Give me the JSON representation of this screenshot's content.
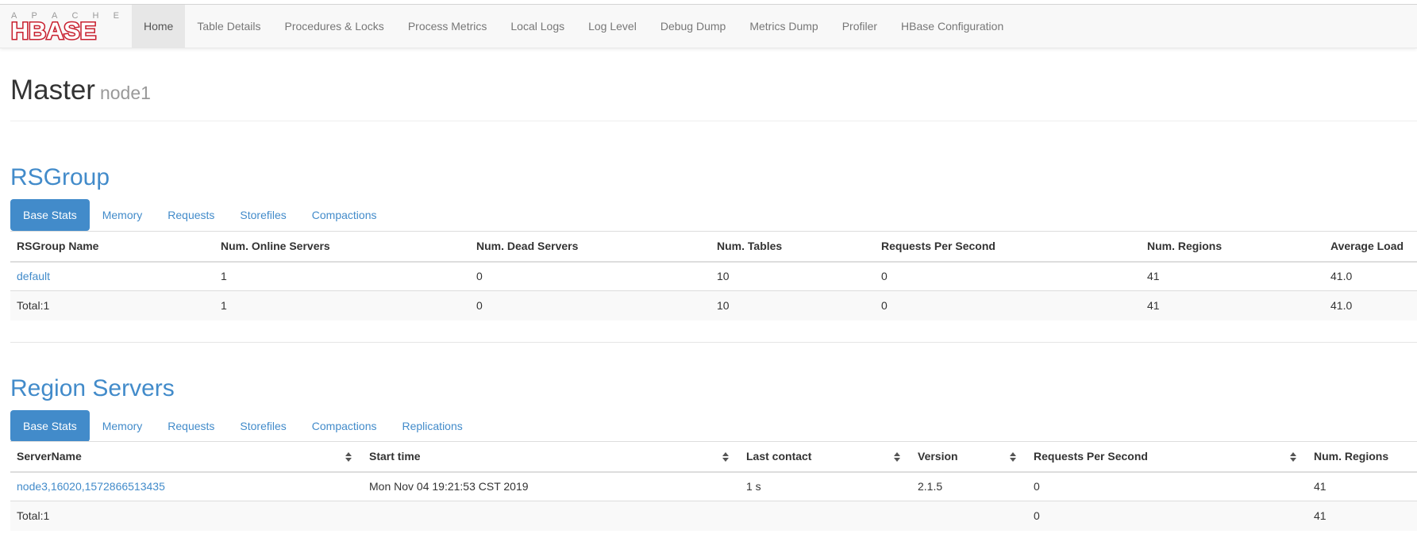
{
  "navbar": {
    "logo_top": "APACHE",
    "logo_main": "HBASE",
    "items": [
      {
        "label": "Home",
        "active": true
      },
      {
        "label": "Table Details"
      },
      {
        "label": "Procedures & Locks"
      },
      {
        "label": "Process Metrics"
      },
      {
        "label": "Local Logs"
      },
      {
        "label": "Log Level"
      },
      {
        "label": "Debug Dump"
      },
      {
        "label": "Metrics Dump"
      },
      {
        "label": "Profiler"
      },
      {
        "label": "HBase Configuration"
      }
    ]
  },
  "header": {
    "title": "Master",
    "subtitle": "node1"
  },
  "rsgroup": {
    "title": "RSGroup",
    "tabs": [
      "Base Stats",
      "Memory",
      "Requests",
      "Storefiles",
      "Compactions"
    ],
    "columns": [
      "RSGroup Name",
      "Num. Online Servers",
      "Num. Dead Servers",
      "Num. Tables",
      "Requests Per Second",
      "Num. Regions",
      "Average Load"
    ],
    "rows": [
      [
        "default",
        "1",
        "0",
        "10",
        "0",
        "41",
        "41.0"
      ],
      [
        "Total:1",
        "1",
        "0",
        "10",
        "0",
        "41",
        "41.0"
      ]
    ]
  },
  "region_servers": {
    "title": "Region Servers",
    "tabs": [
      "Base Stats",
      "Memory",
      "Requests",
      "Storefiles",
      "Compactions",
      "Replications"
    ],
    "columns": [
      "ServerName",
      "Start time",
      "Last contact",
      "Version",
      "Requests Per Second",
      "Num. Regions"
    ],
    "rows": [
      [
        "node3,16020,1572866513435",
        "Mon Nov 04 19:21:53 CST 2019",
        "1 s",
        "2.1.5",
        "0",
        "41"
      ],
      [
        "Total:1",
        "",
        "",
        "",
        "0",
        "41"
      ]
    ]
  },
  "colors": {
    "link": "#428bca",
    "brand_red": "#c8202f",
    "active_tab": "#428bca"
  }
}
